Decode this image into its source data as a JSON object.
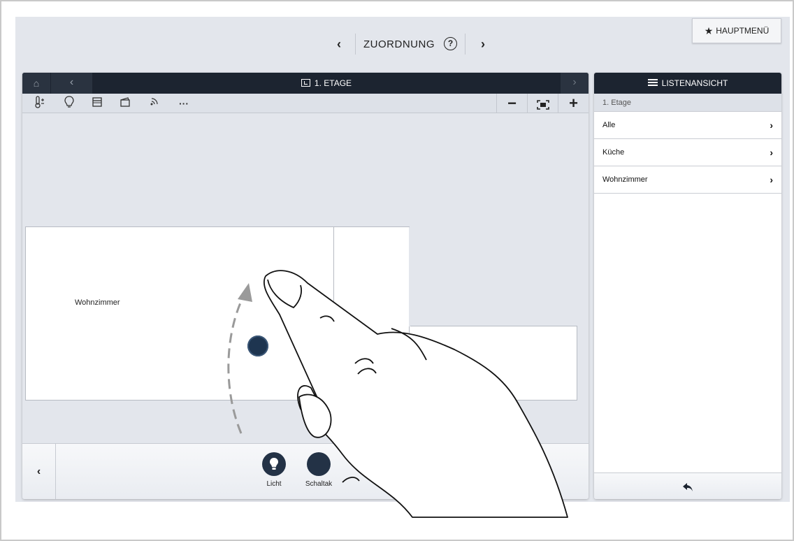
{
  "topnav": {
    "prev": "‹",
    "title": "ZUORDNUNG",
    "help": "?",
    "next": "›",
    "main_menu": "HAUPTMENÜ",
    "main_menu_icon": "star-icon"
  },
  "floorplan": {
    "home_icon": "⌂",
    "back": "‹",
    "forward": "›",
    "title": "1. ETAGE",
    "toolbar_icons": [
      "thermometer-icon",
      "bulb-icon",
      "blind-icon",
      "scene-icon",
      "sensor-icon",
      "more-icon"
    ],
    "toolbar_glyphs": [
      "🌡",
      "💡",
      "▤",
      "◩",
      "◌",
      "···"
    ],
    "zoom_out": "−",
    "fit": "⛶",
    "zoom_in": "+",
    "room_label": "Wohnzimmer",
    "bottom_prev": "‹",
    "devices": [
      {
        "name": "Licht"
      },
      {
        "name": "Schaltak"
      }
    ]
  },
  "list_view": {
    "header": "LISTENANSICHT",
    "breadcrumb": "1. Etage",
    "items": [
      {
        "label": "Alle",
        "chevron": "›"
      },
      {
        "label": "Küche",
        "chevron": "›"
      },
      {
        "label": "Wohnzimmer",
        "chevron": "›"
      }
    ],
    "back_icon": "↩"
  },
  "colors": {
    "header_bg": "#1c2430",
    "device_bg": "#233246",
    "app_bg": "#e3e6ec"
  }
}
